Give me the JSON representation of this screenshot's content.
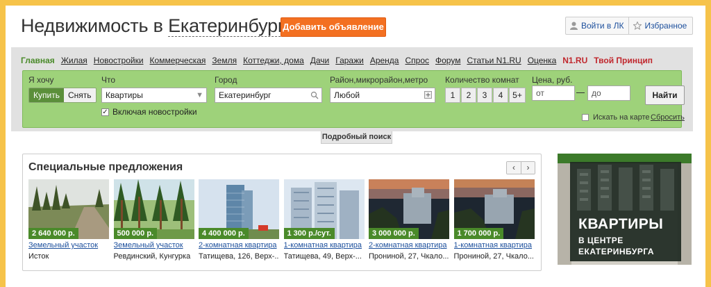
{
  "header": {
    "title_prefix": "Недвижимость в",
    "title_city": "Екатеринбурге",
    "add_button": "Добавить объявление",
    "login": "Войти в ЛК",
    "favorites": "Избранное"
  },
  "nav": {
    "items": [
      "Главная",
      "Жилая",
      "Новостройки",
      "Коммерческая",
      "Земля",
      "Коттеджи, дома",
      "Дачи",
      "Гаражи",
      "Аренда",
      "Спрос",
      "Форум",
      "Статьи N1.RU",
      "Оценка",
      "N1.RU",
      "Твой Принцип"
    ]
  },
  "search": {
    "want_label": "Я хочу",
    "buy": "Купить",
    "rent": "Снять",
    "what_label": "Что",
    "what_value": "Квартиры",
    "include_new": "Включая новостройки",
    "city_label": "Город",
    "city_value": "Екатеринбург",
    "district_label": "Район,микрорайон,метро",
    "district_value": "Любой",
    "rooms_label": "Количество комнат",
    "rooms": [
      "1",
      "2",
      "3",
      "4",
      "5+"
    ],
    "price_label": "Цена, руб.",
    "from_placeholder": "от",
    "to_placeholder": "до",
    "find_button": "Найти",
    "map_search": "Искать на карте",
    "reset": "Сбросить",
    "advanced": "Подробный поиск"
  },
  "offers": {
    "title": "Специальные предложения",
    "prev": "‹",
    "next": "›",
    "cards": [
      {
        "price": "2 640 000 р.",
        "title": "Земельный участок",
        "addr": "Исток"
      },
      {
        "price": "500 000 р.",
        "title": "Земельный участок",
        "addr": "Ревдинский, Кунгурка"
      },
      {
        "price": "4 400 000 р.",
        "title": "2-комнатная квартира",
        "addr": "Татищева, 126, Верх-..."
      },
      {
        "price": "1 300 р./сут.",
        "title": "1-комнатная квартира",
        "addr": "Татищева, 49, Верх-..."
      },
      {
        "price": "3 000 000 р.",
        "title": "2-комнатная квартира",
        "addr": "Прониной, 27, Чкало..."
      },
      {
        "price": "1 700 000 р.",
        "title": "1-комнатная квартира",
        "addr": "Прониной, 27, Чкало..."
      }
    ]
  },
  "banner": {
    "line1": "КВАРТИРЫ",
    "line2": "В ЦЕНТРЕ",
    "line3": "ЕКАТЕРИНБУРГА"
  },
  "colors": {
    "accent_orange": "#f37021",
    "search_green": "#9ed27a",
    "price_green": "#4a8a2a",
    "link_blue": "#1c4f9c",
    "frame_yellow": "#f6c34a"
  }
}
